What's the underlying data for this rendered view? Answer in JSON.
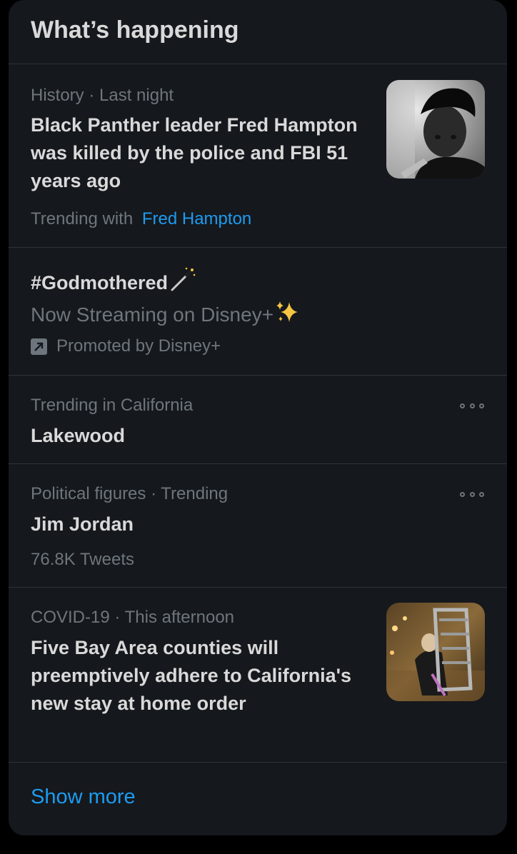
{
  "header": {
    "title": "What’s happening"
  },
  "items": [
    {
      "meta_category": "History",
      "meta_sep": "·",
      "meta_time": "Last night",
      "title": "Black Panther leader Fred Hampton was killed by the police and FBI 51 years ago",
      "trending_prefix": "Trending with",
      "trending_link": "Fred Hampton"
    },
    {
      "title": "#Godmothered",
      "subtitle": "Now Streaming on Disney+",
      "promoted": "Promoted by Disney+"
    },
    {
      "meta": "Trending in California",
      "title": "Lakewood"
    },
    {
      "meta": "Political figures · Trending",
      "title": "Jim Jordan",
      "count": "76.8K Tweets"
    },
    {
      "meta_category": "COVID-19",
      "meta_sep": "·",
      "meta_time": "This afternoon",
      "title": "Five Bay Area counties will preemptively adhere to California's new stay at home order"
    }
  ],
  "footer": {
    "show_more": "Show more"
  },
  "colors": {
    "background": "#15181c",
    "accent": "#1d9bf0",
    "muted": "#6e767d",
    "text": "#d9d9d9",
    "divider": "#2f3336"
  }
}
